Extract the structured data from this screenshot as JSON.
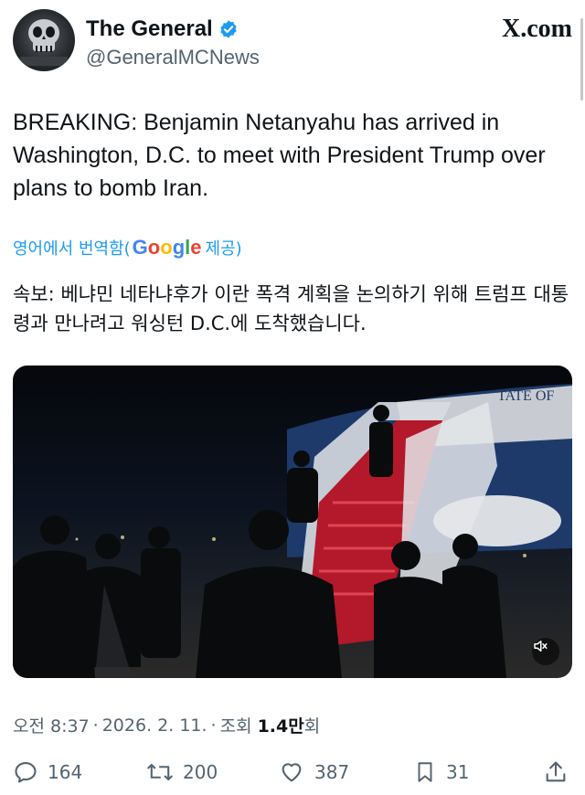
{
  "header": {
    "display_name": "The General",
    "handle": "@GeneralMCNews",
    "site": "X.com",
    "avatar_icon": "skull-avatar",
    "verified_icon": "verified-badge-icon",
    "verified_color": "#1d9bf0"
  },
  "post": {
    "text": "BREAKING: Benjamin Netanyahu has arrived in Washington, D.C. to meet with President Trump over plans to bomb Iran."
  },
  "translation": {
    "prefix": "영어에서 번역함(",
    "brand": [
      "G",
      "o",
      "o",
      "g",
      "l",
      "e"
    ],
    "suffix": "제공)",
    "text": "속보: 베냐민 네타냐후가 이란 폭격 계획을 논의하기 위해 트럼프 대통령과 만나려고 워싱턴 D.C.에 도착했습니다."
  },
  "media": {
    "type": "video",
    "aircraft_text": "TATE OF",
    "mute_icon": "mute-icon"
  },
  "meta": {
    "time": "오전 8:37",
    "separator": "·",
    "date": "2026. 2. 11.",
    "views_label": "조회",
    "views_count": "1.4만",
    "views_suffix": "회"
  },
  "actions": {
    "replies": "164",
    "reposts": "200",
    "likes": "387",
    "bookmarks": "31"
  }
}
